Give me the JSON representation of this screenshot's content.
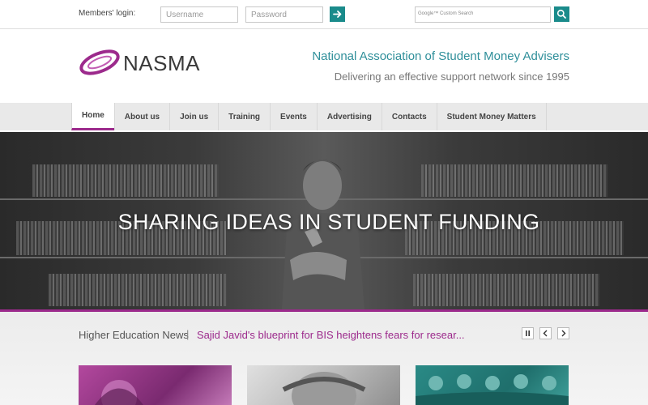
{
  "topbar": {
    "login_label": "Members' login:",
    "username_placeholder": "Username",
    "password_placeholder": "Password",
    "search_brand": "Google™ Custom Search"
  },
  "header": {
    "logo_text": "NASMA",
    "org_name": "National Association of Student Money Advisers",
    "tagline": "Delivering an effective support network since 1995"
  },
  "nav": {
    "items": [
      {
        "label": "Home"
      },
      {
        "label": "About us"
      },
      {
        "label": "Join us"
      },
      {
        "label": "Training"
      },
      {
        "label": "Events"
      },
      {
        "label": "Advertising"
      },
      {
        "label": "Contacts"
      },
      {
        "label": "Student Money Matters"
      }
    ],
    "active": "Home"
  },
  "hero": {
    "title": "SHARING IDEAS IN STUDENT FUNDING"
  },
  "news": {
    "label": "Higher Education News",
    "separator": "|",
    "headline": "Sajid Javid's blueprint for BIS heightens fears for resear..."
  },
  "colors": {
    "accent_teal": "#1a8b8b",
    "accent_purple": "#9c2a8c",
    "org_name_teal": "#2f8f9a"
  },
  "icons": {
    "login_submit": "arrow-right-icon",
    "search_submit": "search-icon",
    "slider_pause": "pause-icon",
    "slider_prev": "chevron-left-icon",
    "slider_next": "chevron-right-icon"
  }
}
